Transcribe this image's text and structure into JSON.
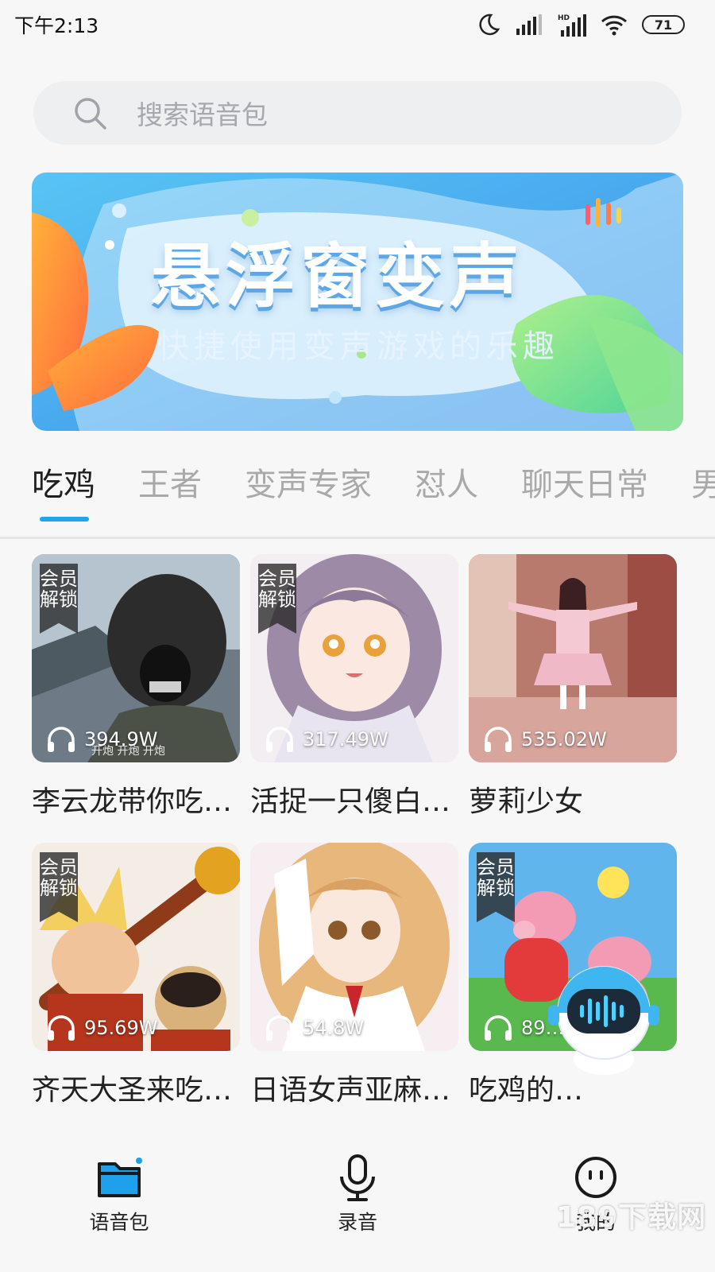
{
  "status_bar": {
    "time": "下午2:13",
    "battery": "71"
  },
  "search": {
    "placeholder": "搜索语音包"
  },
  "banner": {
    "title": "悬浮窗变声",
    "subtitle": "快捷使用变声游戏的乐趣"
  },
  "tabs": [
    "吃鸡",
    "王者",
    "变声专家",
    "怼人",
    "聊天日常",
    "男"
  ],
  "cards": [
    {
      "title": "李云龙带你吃…",
      "plays": "394.9W",
      "badge": "会员解锁",
      "caption": "开炮 开炮 开炮"
    },
    {
      "title": "活捉一只傻白…",
      "plays": "317.49W",
      "badge": "会员解锁"
    },
    {
      "title": "萝莉少女",
      "plays": "535.02W"
    },
    {
      "title": "齐天大圣来吃…",
      "plays": "95.69W",
      "badge": "会员解锁"
    },
    {
      "title": "日语女声亚麻…",
      "plays": "54.8W"
    },
    {
      "title": "吃鸡的…",
      "plays": "89…",
      "badge": "会员解锁"
    }
  ],
  "bottom_nav": [
    {
      "label": "语音包",
      "icon": "folder-icon"
    },
    {
      "label": "录音",
      "icon": "microphone-icon"
    },
    {
      "label": "我的",
      "icon": "smiley-icon"
    }
  ],
  "watermark": "189下载网",
  "colors": {
    "accent": "#22a4e9",
    "banner_bg": "#4fb3ee"
  }
}
